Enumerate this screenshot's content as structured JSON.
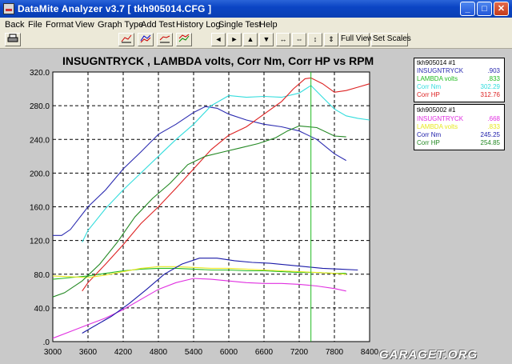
{
  "window": {
    "title": "DataMite Analyzer v3.7  [ tkh905014.CFG ]",
    "minimize": "_",
    "maximize": "□",
    "close": "✕"
  },
  "menu": [
    "Back",
    "File",
    "Format",
    "View",
    "Graph Type",
    "Add Test",
    "History Log",
    "Single Test",
    "Help"
  ],
  "toolbar": {
    "icons": [
      "print-icon",
      "graph-type-1-icon",
      "graph-type-2-icon",
      "graph-type-3-icon",
      "graph-type-4-icon",
      "arrow-left-icon",
      "arrow-right-icon",
      "arrow-up-icon",
      "arrow-down-icon",
      "expand-horizontal-icon",
      "compress-horizontal-icon",
      "compress-vertical-icon",
      "expand-vertical-icon"
    ],
    "full_view": "Full View",
    "set_scales": "Set Scales"
  },
  "chart_data": {
    "type": "line",
    "title": "INSUGNTRYCK , LAMBDA volts, Corr Nm, Corr HP vs RPM",
    "xlabel": "",
    "ylabel": "",
    "xlim": [
      3000,
      8400
    ],
    "ylim": [
      0,
      320
    ],
    "xticks": [
      "3000",
      "3600",
      "4200",
      "4800",
      "5400",
      "6000",
      "6600",
      "7200",
      "7800",
      "8400"
    ],
    "yticks": [
      ".0",
      "40.0",
      "80.0",
      "120.0",
      "160.0",
      "200.0",
      "240.0",
      "280.0",
      "320.0"
    ],
    "cursor_rpm": 7400,
    "series": [
      {
        "name": "INSUGNTRYCK",
        "test": "tkh905014",
        "color": "#2b2bb0",
        "x": [
          3000,
          3150,
          3300,
          3600,
          3900,
          4200,
          4500,
          4800,
          5100,
          5400,
          5600,
          5800,
          6000,
          6300,
          6600,
          6900,
          7200,
          7500,
          7800,
          8000
        ],
        "y": [
          126,
          126,
          133,
          160,
          180,
          205,
          225,
          246,
          258,
          272,
          279,
          277,
          270,
          263,
          258,
          255,
          250,
          240,
          223,
          215
        ]
      },
      {
        "name": "LAMBDA volts",
        "test": "tkh905014",
        "color": "#22bb22",
        "x": [
          3000,
          3300,
          3600,
          3900,
          4200,
          4500,
          4800,
          5100,
          5400,
          5700,
          6000,
          6300,
          6600,
          6900,
          7200,
          7500,
          7800,
          8000
        ],
        "y": [
          74,
          76,
          78,
          81,
          84,
          86,
          87,
          87,
          86,
          85,
          85,
          84,
          84,
          83,
          82,
          82,
          81,
          81
        ]
      },
      {
        "name": "Corr Nm",
        "test": "tkh905014",
        "color": "#33dddd",
        "x": [
          3500,
          3600,
          3900,
          4200,
          4500,
          4800,
          5100,
          5400,
          5700,
          6000,
          6300,
          6600,
          6900,
          7200,
          7400,
          7600,
          7800,
          8000,
          8200,
          8400
        ],
        "y": [
          118,
          132,
          158,
          180,
          200,
          220,
          240,
          258,
          280,
          292,
          290,
          291,
          290,
          295,
          304,
          290,
          276,
          268,
          265,
          263
        ]
      },
      {
        "name": "Corr HP",
        "test": "tkh905014",
        "color": "#dd2222",
        "x": [
          3500,
          3600,
          3900,
          4200,
          4500,
          4800,
          5100,
          5400,
          5700,
          6000,
          6300,
          6600,
          6900,
          7100,
          7300,
          7400,
          7600,
          7800,
          8000,
          8200,
          8400
        ],
        "y": [
          60,
          70,
          92,
          115,
          140,
          160,
          182,
          205,
          228,
          245,
          255,
          270,
          285,
          300,
          312,
          313,
          306,
          296,
          298,
          302,
          306
        ]
      },
      {
        "name": "INSUGNTRYCK",
        "test": "tkh905002",
        "color": "#e030e0",
        "x": [
          3000,
          3300,
          3600,
          3900,
          4200,
          4500,
          4800,
          5100,
          5400,
          5700,
          6000,
          6300,
          6600,
          6900,
          7200,
          7500,
          7800,
          8000
        ],
        "y": [
          4,
          12,
          20,
          28,
          38,
          50,
          62,
          70,
          75,
          74,
          72,
          70,
          69,
          69,
          68,
          66,
          63,
          60
        ]
      },
      {
        "name": "LAMBDA volts",
        "test": "tkh905002",
        "color": "#e8e820",
        "x": [
          3000,
          3300,
          3600,
          3900,
          4200,
          4500,
          4800,
          5100,
          5400,
          5700,
          6000,
          6300,
          6600,
          6900,
          7200,
          7500,
          7800,
          8000
        ],
        "y": [
          78,
          77,
          76,
          79,
          83,
          87,
          89,
          89,
          88,
          87,
          87,
          86,
          85,
          84,
          83,
          82,
          81,
          80
        ]
      },
      {
        "name": "Corr Nm",
        "test": "tkh905002",
        "color": "#1a1aa8",
        "x": [
          3500,
          3700,
          4000,
          4300,
          4600,
          4900,
          5200,
          5500,
          5800,
          6100,
          6400,
          6700,
          7000,
          7300,
          7600,
          7900,
          8200
        ],
        "y": [
          10,
          18,
          30,
          45,
          62,
          80,
          92,
          99,
          99,
          96,
          94,
          93,
          91,
          89,
          87,
          86,
          85
        ]
      },
      {
        "name": "Corr HP",
        "test": "tkh905002",
        "color": "#228822",
        "x": [
          3000,
          3200,
          3500,
          3800,
          4100,
          4400,
          4700,
          5000,
          5300,
          5600,
          5900,
          6200,
          6500,
          6800,
          7000,
          7200,
          7500,
          7800,
          8000
        ],
        "y": [
          53,
          58,
          72,
          92,
          118,
          148,
          170,
          188,
          210,
          220,
          225,
          230,
          235,
          242,
          250,
          256,
          254,
          244,
          243
        ]
      }
    ]
  },
  "legend": [
    {
      "header": "tkh905014  #1",
      "rows": [
        {
          "name": "INSUGNTRYCK",
          "value": ".903",
          "color": "#2b2bb0"
        },
        {
          "name": "LAMBDA volts",
          "value": ".833",
          "color": "#22bb22"
        },
        {
          "name": "Corr Nm",
          "value": "302.29",
          "color": "#33dddd"
        },
        {
          "name": "Corr HP",
          "value": "312.76",
          "color": "#dd2222"
        }
      ]
    },
    {
      "header": "tkh905002  #1",
      "rows": [
        {
          "name": "INSUGNTRYCK",
          "value": ".668",
          "color": "#e030e0"
        },
        {
          "name": "LAMBDA volts",
          "value": ".833",
          "color": "#e8e820"
        },
        {
          "name": "Corr Nm",
          "value": "245.25",
          "color": "#1a1aa8"
        },
        {
          "name": "Corr HP",
          "value": "254.85",
          "color": "#228822"
        }
      ]
    }
  ],
  "watermark": "GARAGET.ORG"
}
